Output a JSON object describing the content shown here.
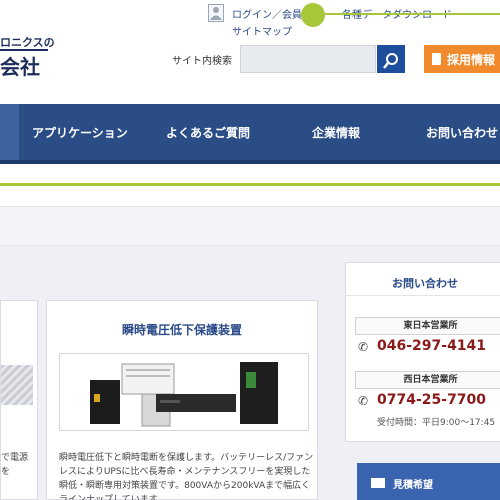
{
  "logo": {
    "partial_text": "ロニクスの",
    "company_text": "会社"
  },
  "header": {
    "login_link": "ログイン／会員登録",
    "download_link": "各種データダウンロード",
    "sitemap_link": "サイトマップ",
    "search_label": "サイト内検索",
    "search_placeholder": "",
    "recruit_label": "採用情報"
  },
  "nav": {
    "items": [
      {
        "label": "アプリケーション"
      },
      {
        "label": "よくあるご質問"
      },
      {
        "label": "企業情報"
      },
      {
        "label": "お問い合わせ"
      }
    ]
  },
  "cards": {
    "left_partial_text": [
      "で電源",
      "を"
    ],
    "mid": {
      "title": "瞬時電圧低下保護装置",
      "description": "瞬時電圧低下と瞬時電断を保護します。バッテリーレス/ファンレスによりUPSに比べ長寿命・メンテナンスフリーを実現した瞬低・瞬断専用対策装置です。800VAから200kVAまで幅広くラインナップしています。"
    }
  },
  "contact": {
    "title": "お問い合わせ",
    "offices": [
      {
        "label": "東日本営業所",
        "phone": "046-297-4141"
      },
      {
        "label": "西日本営業所",
        "phone": "0774-25-7700"
      }
    ],
    "hours": "受付時間：平日9:00～17:45"
  },
  "estimate": {
    "label": "見積希望"
  },
  "colors": {
    "nav_bg": "#2b4d86",
    "accent_green": "#a8c63a",
    "recruit_orange": "#f08a2c",
    "link_blue": "#2a4a88",
    "phone_red": "#8a1a1a"
  }
}
